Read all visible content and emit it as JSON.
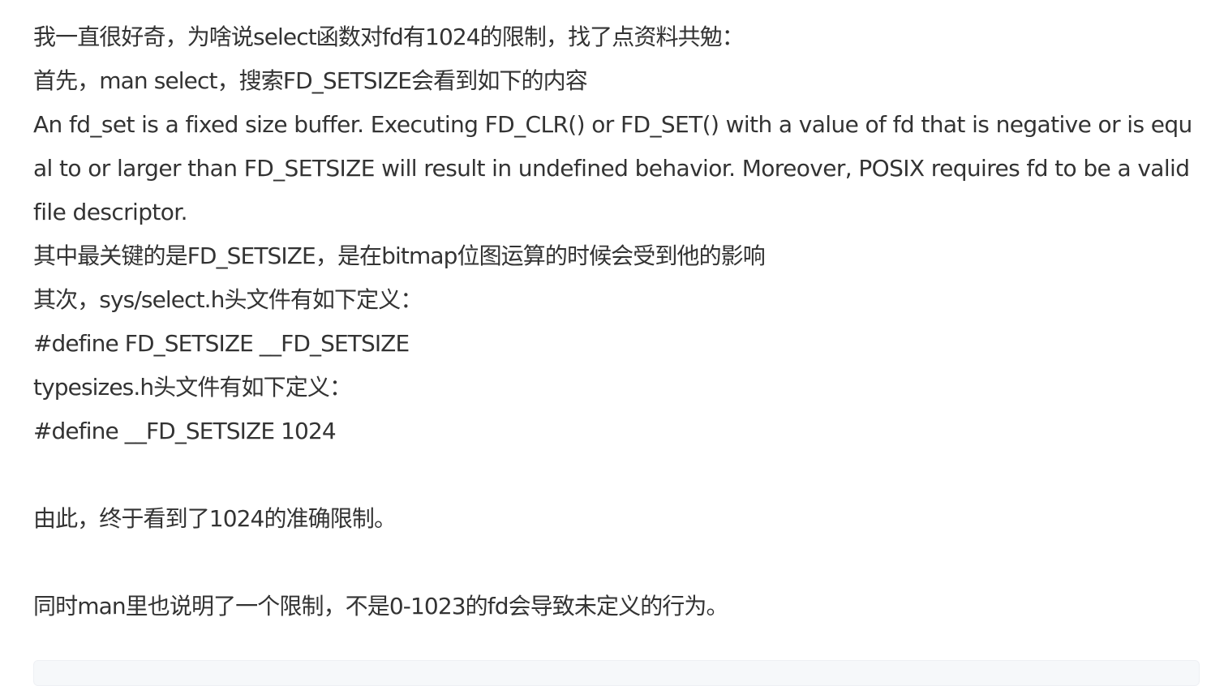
{
  "article": {
    "line1": "我一直很好奇，为啥说select函数对fd有1024的限制，找了点资料共勉：",
    "line2": "首先，man select，搜索FD_SETSIZE会看到如下的内容",
    "paragraph_en": "An fd_set is a fixed size buffer. Executing FD_CLR() or FD_SET() with a value of fd that is negative or is equal to or larger than FD_SETSIZE will result in undefined behavior. Moreover, POSIX requires fd to be a valid file descriptor.",
    "line3": "其中最关键的是FD_SETSIZE，是在bitmap位图运算的时候会受到他的影响",
    "line4": "其次，sys/select.h头文件有如下定义：",
    "line5": "#define FD_SETSIZE __FD_SETSIZE",
    "line6": "typesizes.h头文件有如下定义：",
    "line7": "#define __FD_SETSIZE 1024",
    "line8": "由此，终于看到了1024的准确限制。",
    "line9": "同时man里也说明了一个限制，不是0-1023的fd会导致未定义的行为。"
  }
}
